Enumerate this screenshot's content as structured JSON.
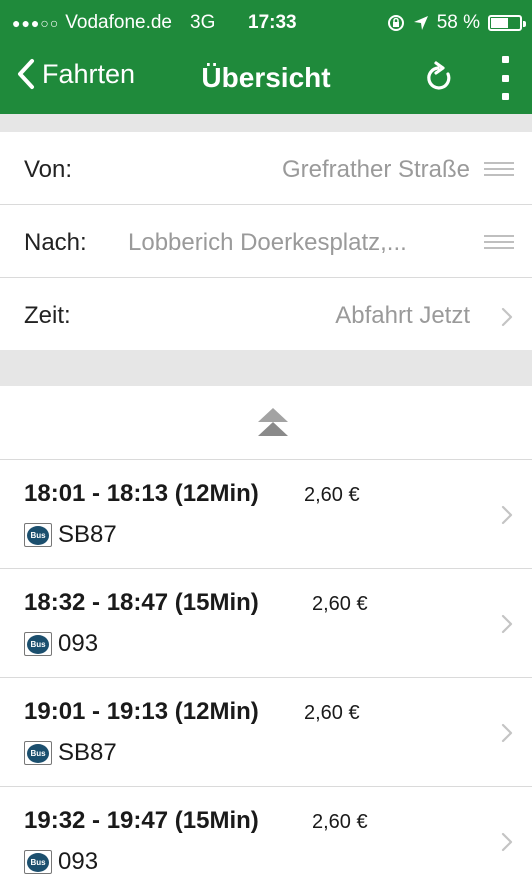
{
  "status_bar": {
    "signal": "●●●○○",
    "carrier": "Vodafone.de",
    "network": "3G",
    "time": "17:33",
    "battery": "58 %"
  },
  "nav": {
    "back_label": "Fahrten",
    "title": "Übersicht",
    "icons": [
      "chevron-left-icon",
      "refresh-icon",
      "more-vertical-icon"
    ]
  },
  "form": {
    "from_label": "Von:",
    "from_value": "Grefrather Straße",
    "to_label": "Nach:",
    "to_value": "Lobberich Doerkesplatz,...",
    "time_label": "Zeit:",
    "time_value": "Abfahrt Jetzt"
  },
  "trips": [
    {
      "times": "18:01 - 18:13 (12Min)",
      "price": "2,60 €",
      "line": "SB87",
      "badge": "Bus"
    },
    {
      "times": "18:32 - 18:47 (15Min)",
      "price": "2,60 €",
      "line": "093",
      "badge": "Bus"
    },
    {
      "times": "19:01 - 19:13 (12Min)",
      "price": "2,60 €",
      "line": "SB87",
      "badge": "Bus"
    },
    {
      "times": "19:32 - 19:47 (15Min)",
      "price": "2,60 €",
      "line": "093",
      "badge": "Bus"
    }
  ],
  "colors": {
    "header": "#1f8a3b",
    "divider": "#e6e6e6",
    "secondary_text": "#9a9a9a",
    "bus_badge": "#1b4f6e"
  }
}
